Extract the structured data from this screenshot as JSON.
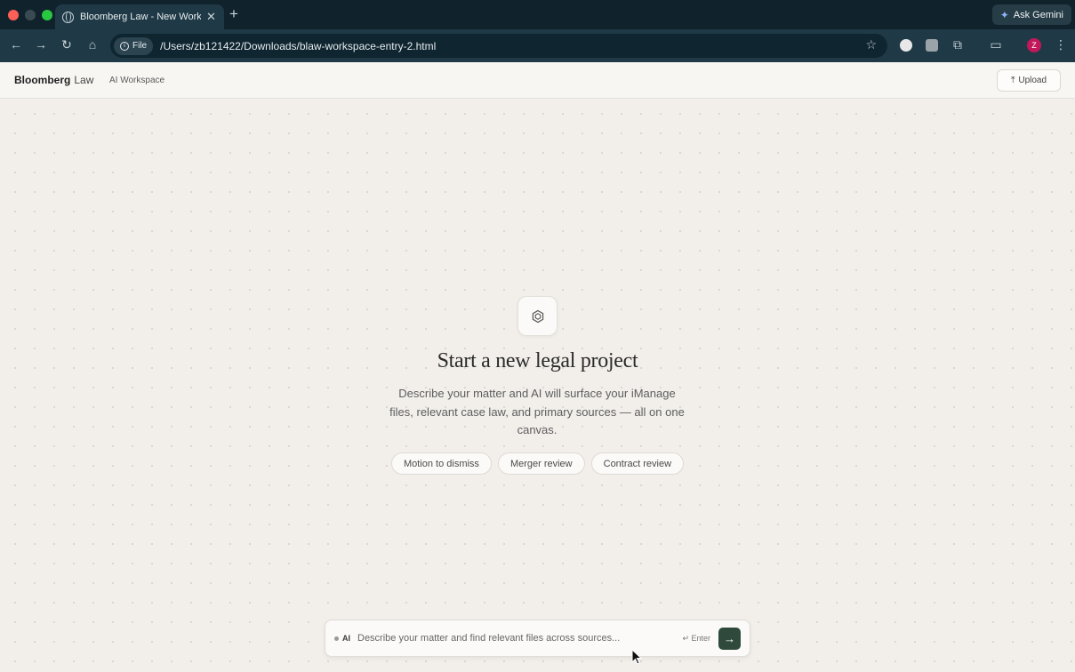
{
  "browser": {
    "tab_title": "Bloomberg Law - New Worksp",
    "new_tab_symbol": "+",
    "gemini_label": "Ask Gemini",
    "file_chip_label": "File",
    "url": "/Users/zb121422/Downloads/blaw-workspace-entry-2.html",
    "profile_initial": "Z",
    "colors": {
      "frame": "#10222b",
      "toolbar": "#1f3a46",
      "profile": "#c2185b"
    }
  },
  "app": {
    "brand_bold": "Bloomberg",
    "brand_light": "Law",
    "subnav": "AI Workspace",
    "upload_label": "Upload"
  },
  "hero": {
    "icon": "hexagon-icon",
    "title": "Start a new legal project",
    "description": "Describe your matter and AI will surface your iManage files, relevant case law, and primary sources — all on one canvas."
  },
  "suggestions": [
    {
      "label": "Motion to dismiss"
    },
    {
      "label": "Merger review"
    },
    {
      "label": "Contract review"
    }
  ],
  "composer": {
    "ai_label": "AI",
    "placeholder": "Describe your matter and find relevant files across sources...",
    "value": "",
    "enter_hint": "↵ Enter",
    "send_icon": "arrow-right-icon",
    "accent": "#2f4a3c"
  }
}
